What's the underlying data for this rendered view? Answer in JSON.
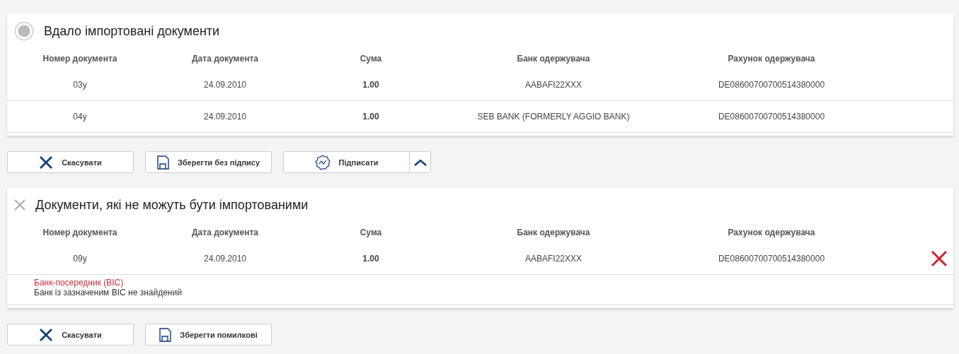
{
  "sections": [
    {
      "kind": "success",
      "title": "Вдало імпортовані документи",
      "columns": [
        "Номер документа",
        "Дата документа",
        "Сума",
        "Банк одержувача",
        "Рахунок одержувача"
      ],
      "rows": [
        {
          "number": "03у",
          "date": "24.09.2010",
          "amount": "1.00",
          "bank": "AABAFI22XXX",
          "account": "DE08600700700514380000",
          "removable": false
        },
        {
          "number": "04у",
          "date": "24.09.2010",
          "amount": "1.00",
          "bank": "SEB BANK (FORMERLY AGGIO BANK)",
          "account": "DE08600700700514380000",
          "removable": false
        }
      ],
      "buttons": [
        {
          "kind": "cancel",
          "label": "Скасувати"
        },
        {
          "kind": "save",
          "label": "Зберегти без підпису"
        },
        {
          "kind": "sign",
          "label": "Підписати",
          "has_menu": true
        }
      ]
    },
    {
      "kind": "error",
      "title": "Документи, які не можуть бути імпортованими",
      "columns": [
        "Номер документа",
        "Дата документа",
        "Сума",
        "Банк одержувача",
        "Рахунок одержувача"
      ],
      "rows": [
        {
          "number": "09у",
          "date": "24.09.2010",
          "amount": "1.00",
          "bank": "AABAFI22XXX",
          "account": "DE08600700700514380000",
          "removable": true,
          "error": {
            "field": "Банк-посередник (BIC)",
            "message": "Банк із зазначеним BIC не знайдений"
          }
        }
      ],
      "buttons": [
        {
          "kind": "cancel",
          "label": "Скасувати"
        },
        {
          "kind": "save",
          "label": "Зберегти помилкові"
        }
      ]
    }
  ]
}
